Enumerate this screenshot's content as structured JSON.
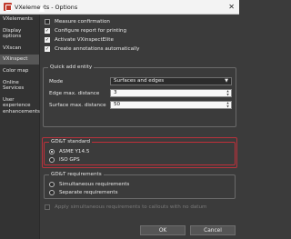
{
  "window": {
    "app_name": "VXelements",
    "separator": " - ",
    "title": "Options",
    "close_glyph": "✕"
  },
  "sidebar": {
    "items": [
      {
        "label": "VXelements",
        "active": false
      },
      {
        "label": "Display options",
        "active": false
      },
      {
        "label": "VXscan",
        "active": false
      },
      {
        "label": "VXinspect",
        "active": true
      },
      {
        "label": "Color map",
        "active": false
      },
      {
        "label": "Online Services",
        "active": false
      },
      {
        "label": "User experience enhancements",
        "active": false
      }
    ]
  },
  "checks": [
    {
      "label": "Measure confirmation",
      "checked": false
    },
    {
      "label": "Configure report for printing",
      "checked": true
    },
    {
      "label": "Activate VXinspectElite",
      "checked": true
    },
    {
      "label": "Create annotations automatically",
      "checked": true
    }
  ],
  "quick_add": {
    "title": "Quick add entity",
    "mode_label": "Mode",
    "mode_value": "Surfaces and edges",
    "edge_label": "Edge max. distance",
    "edge_value": "3",
    "surface_label": "Surface max. distance",
    "surface_value": "50"
  },
  "gdt_standard": {
    "title": "GD&T standard",
    "highlight_color": "#c0303a",
    "options": [
      {
        "label": "ASME Y14.5",
        "checked": true
      },
      {
        "label": "ISO GPS",
        "checked": false
      }
    ]
  },
  "gdt_requirements": {
    "title": "GD&T requirements",
    "options": [
      {
        "label": "Simultaneous requirements",
        "checked": false
      },
      {
        "label": "Separate requirements",
        "checked": false
      }
    ]
  },
  "apply_check": {
    "label": "Apply simultaneous requirements to callouts with no datum",
    "checked": false,
    "disabled": true
  },
  "footer": {
    "ok_label": "OK",
    "cancel_label": "Cancel"
  }
}
